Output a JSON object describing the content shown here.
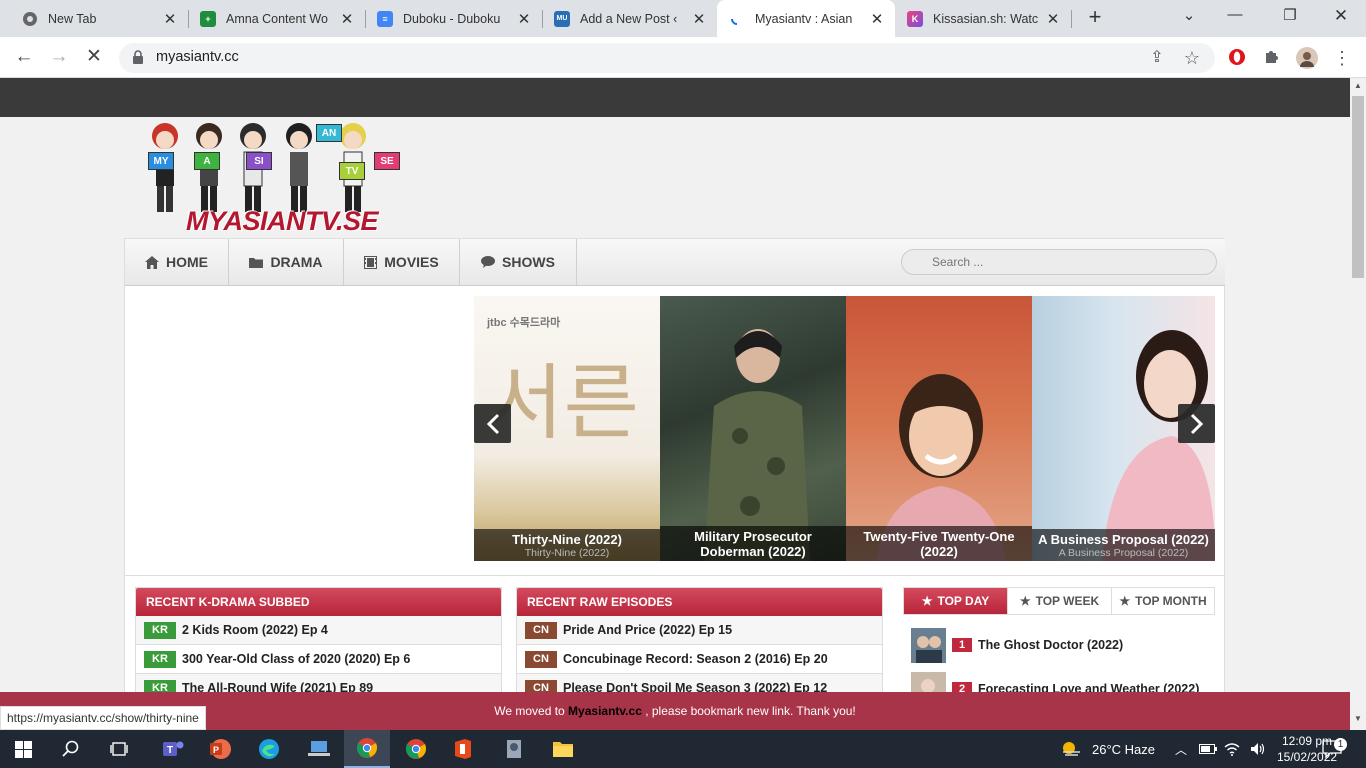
{
  "tabs": [
    {
      "title": "New Tab"
    },
    {
      "title": "Amna Content Wo"
    },
    {
      "title": "Duboku - Duboku"
    },
    {
      "title": "Add a New Post ‹"
    },
    {
      "title": "Myasiantv : Asian"
    },
    {
      "title": "Kissasian.sh: Watc"
    }
  ],
  "address": {
    "url": "myasiantv.cc"
  },
  "site": {
    "logo_text": "MYASIANTV.SE",
    "logo_signs": [
      "MY",
      "A",
      "SI",
      "AN",
      "TV",
      "SE"
    ]
  },
  "nav": {
    "items": [
      "HOME",
      "DRAMA",
      "MOVIES",
      "SHOWS"
    ],
    "search_placeholder": "Search ..."
  },
  "slider": {
    "slides": [
      {
        "title": "Thirty-Nine (2022)",
        "subtitle": "Thirty-Nine (2022)",
        "poster_text": "서른",
        "badge": "jtbc 수목드라마"
      },
      {
        "title": "Military Prosecutor Doberman (2022)",
        "subtitle": ""
      },
      {
        "title": "Twenty-Five Twenty-One (2022)",
        "subtitle": ""
      },
      {
        "title": "A Business Proposal (2022)",
        "subtitle": "A Business Proposal (2022)"
      }
    ]
  },
  "kdrama": {
    "header": "RECENT K-DRAMA SUBBED",
    "rows": [
      {
        "badge": "KR",
        "title": "2 Kids Room (2022) Ep 4"
      },
      {
        "badge": "KR",
        "title": "300 Year-Old Class of 2020 (2020) Ep 6"
      },
      {
        "badge": "KR",
        "title": "The All-Round Wife (2021) Ep 89"
      }
    ]
  },
  "raw": {
    "header": "RECENT RAW EPISODES",
    "rows": [
      {
        "badge": "CN",
        "title": "Pride And Price (2022) Ep 15"
      },
      {
        "badge": "CN",
        "title": "Concubinage Record: Season 2 (2016) Ep 20"
      },
      {
        "badge": "CN",
        "title": "Please Don't Spoil Me Season 3 (2022) Ep 12"
      }
    ]
  },
  "top": {
    "tabs": [
      "TOP DAY",
      "TOP WEEK",
      "TOP MONTH"
    ],
    "items": [
      {
        "rank": "1",
        "title": "The Ghost Doctor (2022)"
      },
      {
        "rank": "2",
        "title": "Forecasting Love and Weather (2022)"
      }
    ]
  },
  "notice": {
    "before": "We moved to ",
    "link": "Myasiantv.cc",
    "after": " , please bookmark new link. Thank you!"
  },
  "status_url": "https://myasiantv.cc/show/thirty-nine",
  "taskbar": {
    "weather": "26°C  Haze",
    "time": "12:09 pm",
    "date": "15/02/2022",
    "notifications": "1"
  },
  "colors": {
    "accent": "#b8253a",
    "kr_badge": "#3a9b3a",
    "cn_badge": "#8a4a32",
    "topbar": "#3a3a3a",
    "taskbar": "#202833"
  }
}
